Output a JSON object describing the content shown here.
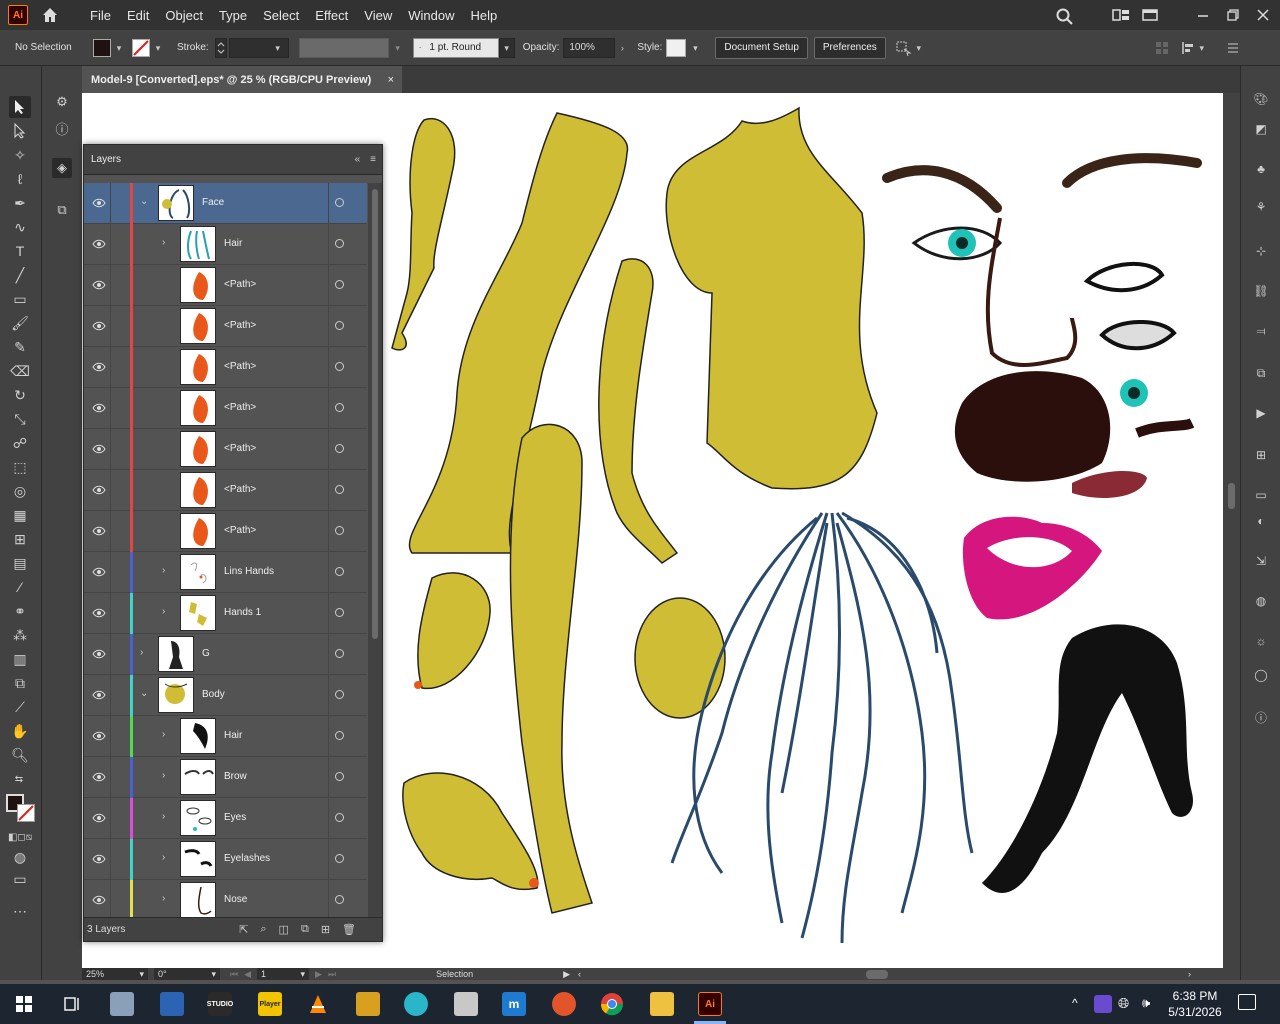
{
  "app": {
    "logo_text": "Ai",
    "menus": [
      "File",
      "Edit",
      "Object",
      "Type",
      "Select",
      "Effect",
      "View",
      "Window",
      "Help"
    ]
  },
  "control": {
    "selection_label": "No Selection",
    "stroke_label": "Stroke:",
    "brush_value": "1 pt. Round",
    "opacity_label": "Opacity:",
    "opacity_value": "100%",
    "style_label": "Style:",
    "document_setup": "Document Setup",
    "preferences": "Preferences"
  },
  "document": {
    "tab_title": "Model-9 [Converted].eps* @ 25 % (RGB/CPU Preview)",
    "close_glyph": "×"
  },
  "layers_panel": {
    "tab_label": "Layers",
    "footer_count": "3 Layers",
    "rows": [
      {
        "name": "Face",
        "indent": 0,
        "twist": "v",
        "color": "#e04646",
        "selected": true
      },
      {
        "name": "Hair",
        "indent": 1,
        "twist": ">",
        "color": "#e04646",
        "selected": false
      },
      {
        "name": "<Path>",
        "indent": 1,
        "twist": "",
        "color": "#e04646",
        "selected": false
      },
      {
        "name": "<Path>",
        "indent": 1,
        "twist": "",
        "color": "#e04646",
        "selected": false
      },
      {
        "name": "<Path>",
        "indent": 1,
        "twist": "",
        "color": "#e04646",
        "selected": false
      },
      {
        "name": "<Path>",
        "indent": 1,
        "twist": "",
        "color": "#e04646",
        "selected": false
      },
      {
        "name": "<Path>",
        "indent": 1,
        "twist": "",
        "color": "#e04646",
        "selected": false
      },
      {
        "name": "<Path>",
        "indent": 1,
        "twist": "",
        "color": "#e04646",
        "selected": false
      },
      {
        "name": "<Path>",
        "indent": 1,
        "twist": "",
        "color": "#e04646",
        "selected": false
      },
      {
        "name": "Lins Hands",
        "indent": 1,
        "twist": ">",
        "color": "#4b61d1",
        "selected": false
      },
      {
        "name": "Hands 1",
        "indent": 1,
        "twist": ">",
        "color": "#3fd3c9",
        "selected": false
      },
      {
        "name": "G",
        "indent": 0,
        "twist": ">",
        "color": "#4b61d1",
        "selected": false
      },
      {
        "name": "Body",
        "indent": 0,
        "twist": "v",
        "color": "#3fd3c9",
        "selected": false
      },
      {
        "name": "Hair",
        "indent": 1,
        "twist": ">",
        "color": "#4fdc4f",
        "selected": false
      },
      {
        "name": "Brow",
        "indent": 1,
        "twist": ">",
        "color": "#4b61d1",
        "selected": false
      },
      {
        "name": "Eyes",
        "indent": 1,
        "twist": ">",
        "color": "#d94fd9",
        "selected": false
      },
      {
        "name": "Eyelashes",
        "indent": 1,
        "twist": ">",
        "color": "#3fd3c9",
        "selected": false
      },
      {
        "name": "Nose",
        "indent": 1,
        "twist": ">",
        "color": "#e0e050",
        "selected": false
      }
    ]
  },
  "status": {
    "zoom": "25%",
    "rotation": "0°",
    "artboard": "1",
    "tool": "Selection"
  },
  "taskbar": {
    "time": "6:38 PM",
    "date": "5/31/2026",
    "ai_label": "Ai",
    "player_label": "Player",
    "studio_label": "STUDIO"
  },
  "colors": {
    "skin": "#d0bd36",
    "orange": "#e9581a",
    "hair_blue": "#2a4a6c",
    "lips": "#d4167e",
    "brown": "#2b0f0c",
    "selected_row": "#4b6990"
  }
}
